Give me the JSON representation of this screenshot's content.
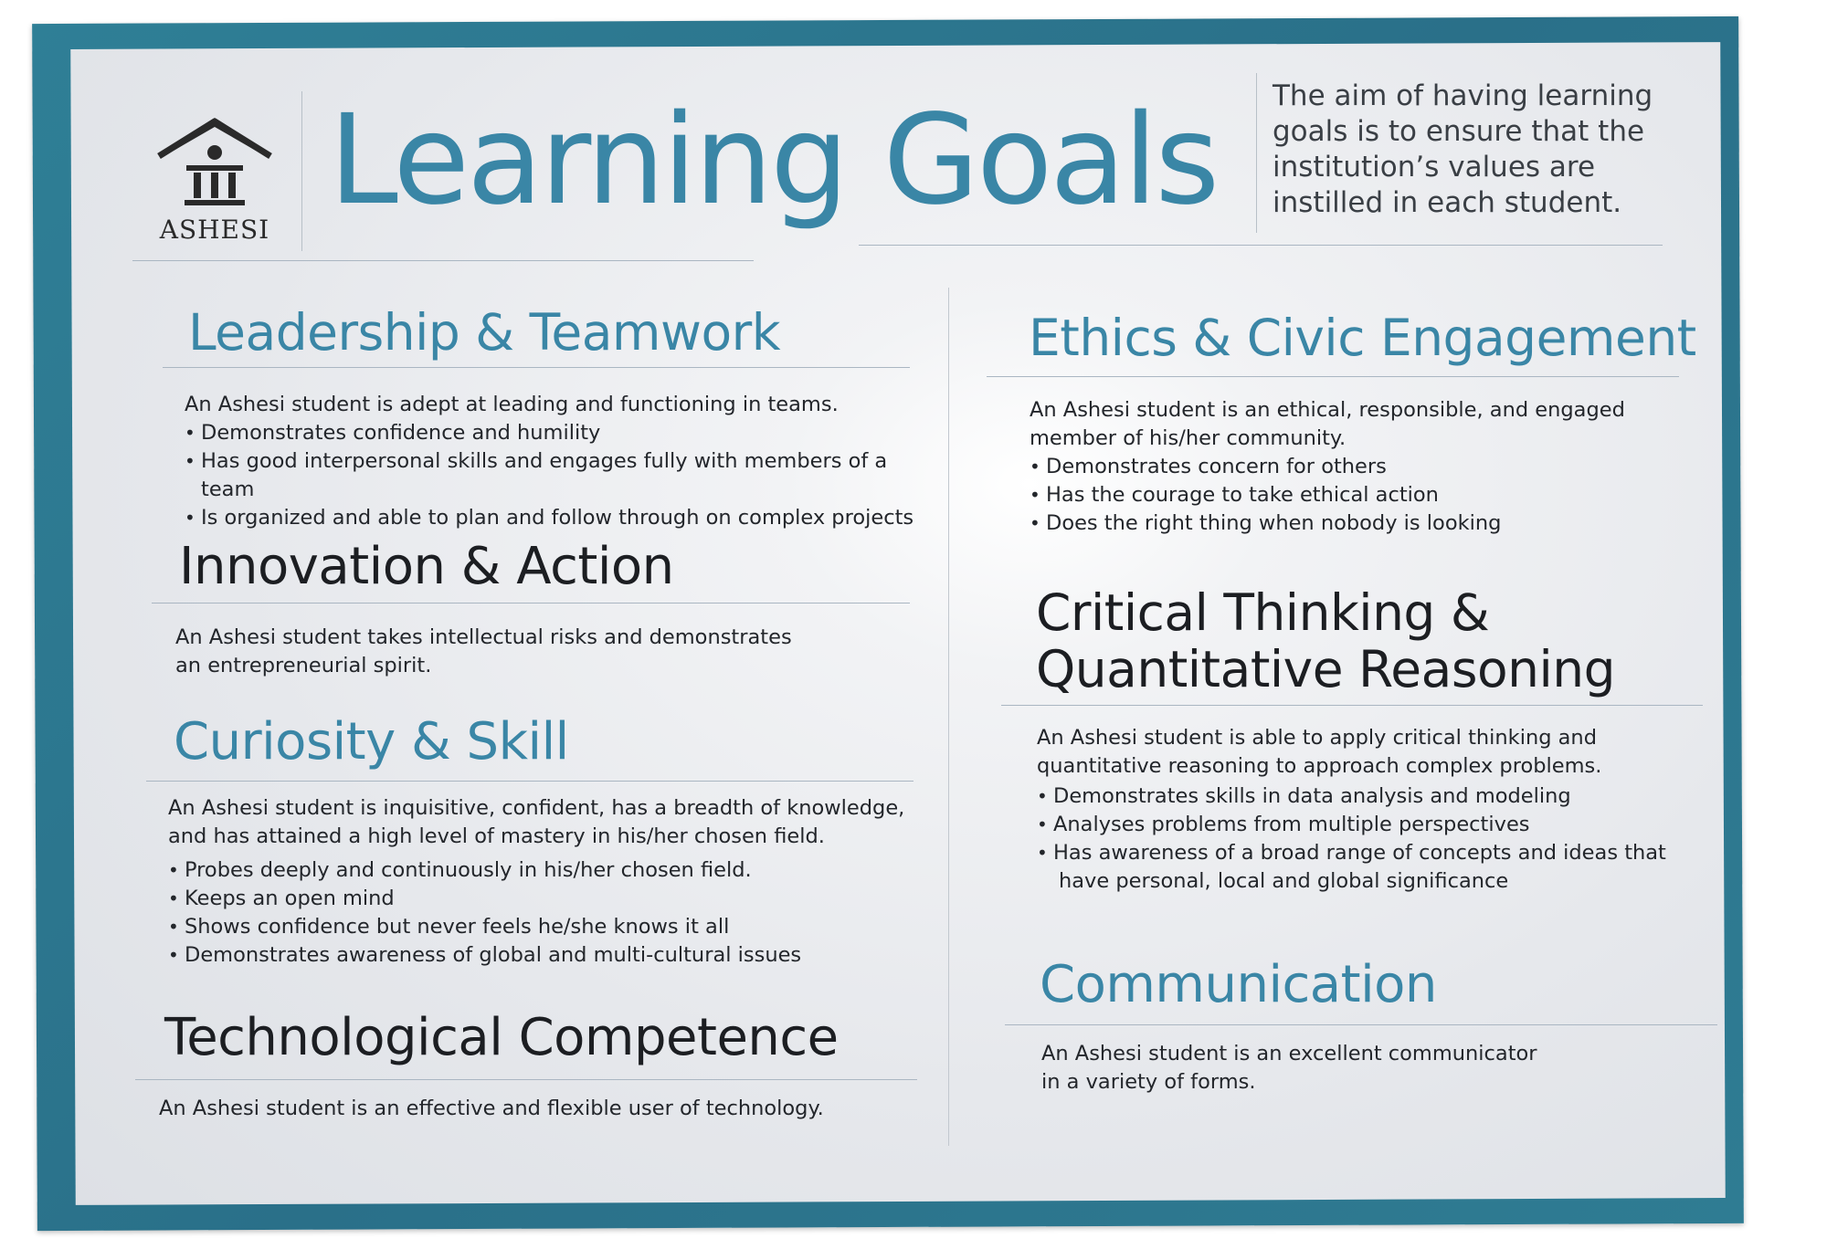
{
  "logo": {
    "name": "ASHESI"
  },
  "title": "Learning Goals",
  "intro": "The aim of having learning goals is to ensure that the institution’s values are instilled in each student.",
  "sections": {
    "leadership": {
      "heading": "Leadership & Teamwork",
      "lead": "An Ashesi student is adept at leading and functioning in teams.",
      "bullets": [
        "Demonstrates confidence and humility",
        "Has good interpersonal skills and engages fully with members of a team",
        "Is organized and able to plan and follow through on complex projects"
      ]
    },
    "innovation": {
      "heading": "Innovation & Action",
      "lead_line1": "An Ashesi student takes intellectual risks and demonstrates",
      "lead_line2": "an entrepreneurial spirit."
    },
    "curiosity": {
      "heading": "Curiosity & Skill",
      "lead_line1": "An Ashesi student is inquisitive, confident, has a breadth of knowledge,",
      "lead_line2": "and has attained a high level of mastery in his/her chosen field.",
      "bullets": [
        "Probes deeply and continuously in his/her chosen field.",
        "Keeps an open mind",
        "Shows confidence but never feels he/she knows it all",
        "Demonstrates awareness of global and multi-cultural issues"
      ]
    },
    "technology": {
      "heading": "Technological Competence",
      "lead": "An Ashesi student is an effective and flexible user of technology."
    },
    "ethics": {
      "heading": "Ethics & Civic Engagement",
      "lead_line1": "An Ashesi student is an ethical, responsible, and engaged",
      "lead_line2": "member of his/her community.",
      "bullets": [
        "Demonstrates concern for others",
        "Has the courage to take ethical action",
        "Does the right thing when nobody is looking"
      ]
    },
    "critical": {
      "heading_line1": "Critical Thinking &",
      "heading_line2": "Quantitative Reasoning",
      "lead_line1": "An Ashesi student is able to apply critical thinking and",
      "lead_line2": "quantitative reasoning to approach complex problems.",
      "bullets": [
        "Demonstrates skills in data analysis and modeling",
        "Analyses problems from multiple perspectives",
        "Has awareness of a broad range of concepts and ideas that"
      ],
      "bullet_continuation": "have personal, local and global significance"
    },
    "communication": {
      "heading": "Communication",
      "lead_line1": "An Ashesi student is an excellent communicator",
      "lead_line2": "in a variety of forms."
    }
  }
}
